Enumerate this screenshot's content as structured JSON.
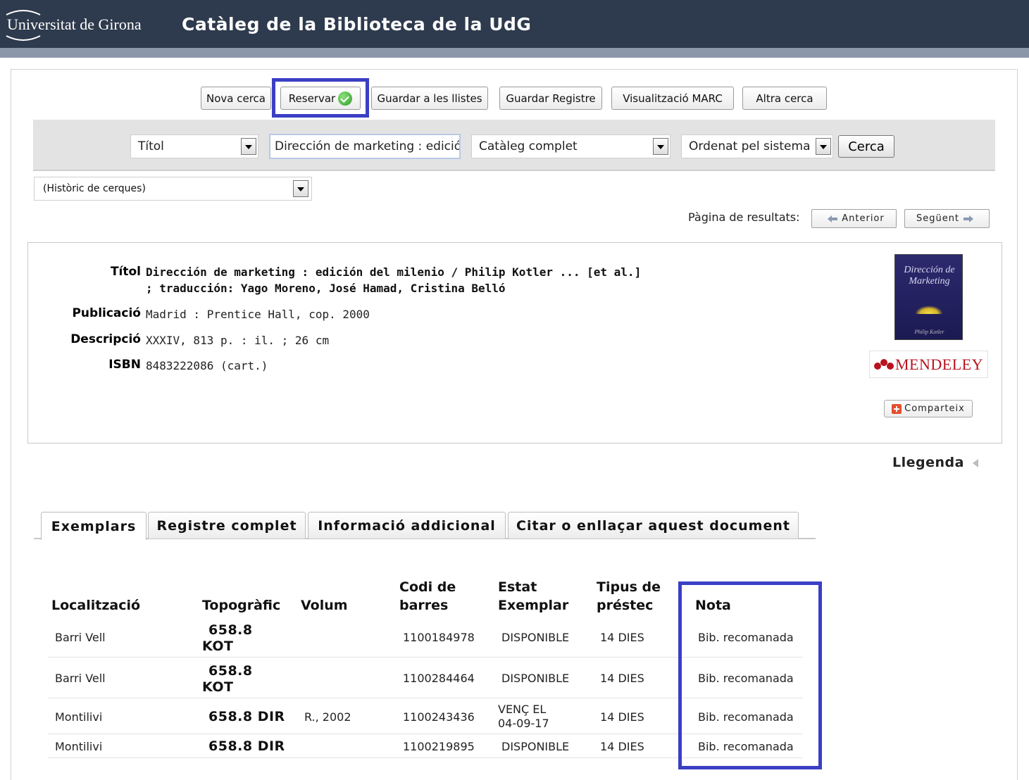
{
  "header": {
    "university": "Universitat de Girona",
    "title": "Catàleg de la Biblioteca de la UdG"
  },
  "toolbar": {
    "new_search": "Nova cerca",
    "reserve": "Reservar",
    "save_lists": "Guardar a les llistes",
    "save_record": "Guardar Registre",
    "marc_view": "Visualització MARC",
    "other_search": "Altra cerca"
  },
  "search": {
    "field_select": "Títol",
    "query": "Dirección de marketing : edición del milenio",
    "scope_select": "Catàleg complet",
    "sort_select": "Ordenat pel sistema",
    "submit": "Cerca",
    "history": "(Històric de cerques)"
  },
  "paging": {
    "label": "Pàgina de resultats:",
    "previous": "Anterior",
    "next": "Següent"
  },
  "record": {
    "title_label": "Títol",
    "title_line1": "Dirección de marketing : edición del milenio / Philip Kotler ... [et al.]",
    "title_line2": "; traducción: Yago Moreno, José Hamad, Cristina Belló",
    "pub_label": "Publicació",
    "pub_value": "Madrid : Prentice Hall, cop. 2000",
    "desc_label": "Descripció",
    "desc_value": "XXXIV, 813 p. : il. ; 26 cm",
    "isbn_label": "ISBN",
    "isbn_value": "8483222086 (cart.)"
  },
  "cover": {
    "title": "Dirección de Marketing",
    "author": "Philip Kotler"
  },
  "sidebar": {
    "mendeley": "MENDELEY",
    "share": "Comparteix",
    "legend": "Llegenda"
  },
  "tabs": [
    {
      "label": "Exemplars"
    },
    {
      "label": "Registre complet"
    },
    {
      "label": "Informació addicional"
    },
    {
      "label": "Citar o enllaçar aquest document"
    }
  ],
  "table": {
    "headers": {
      "location": "Localització",
      "topo": "Topogràfic",
      "volume": "Volum",
      "barcode_1": "Codi de",
      "barcode_2": "barres",
      "status_1": "Estat",
      "status_2": "Exemplar",
      "loan_1": "Tipus de",
      "loan_2": "préstec",
      "note": "Nota"
    },
    "rows": [
      {
        "location": "Barri Vell",
        "topo_1": "658.8",
        "topo_2": "KOT",
        "volume": "",
        "barcode": "1100184978",
        "status_1": "DISPONIBLE",
        "status_2": "",
        "loan": "14 DIES",
        "note": "Bib. recomanada"
      },
      {
        "location": "Barri Vell",
        "topo_1": "658.8",
        "topo_2": "KOT",
        "volume": "",
        "barcode": "1100284464",
        "status_1": "DISPONIBLE",
        "status_2": "",
        "loan": "14 DIES",
        "note": "Bib. recomanada"
      },
      {
        "location": "Montilivi",
        "topo_1": "658.8 DIR",
        "topo_2": "",
        "volume": "R., 2002",
        "barcode": "1100243436",
        "status_1": "VENÇ EL",
        "status_2": "04-09-17",
        "loan": "14 DIES",
        "note": "Bib. recomanada"
      },
      {
        "location": "Montilivi",
        "topo_1": "658.8 DIR",
        "topo_2": "",
        "volume": "",
        "barcode": "1100219895",
        "status_1": "DISPONIBLE",
        "status_2": "",
        "loan": "14 DIES",
        "note": "Bib. recomanada"
      }
    ]
  },
  "colors": {
    "header_bg": "#2e3a4d",
    "highlight": "#3b3fc4",
    "mendeley_red": "#b8131f"
  }
}
